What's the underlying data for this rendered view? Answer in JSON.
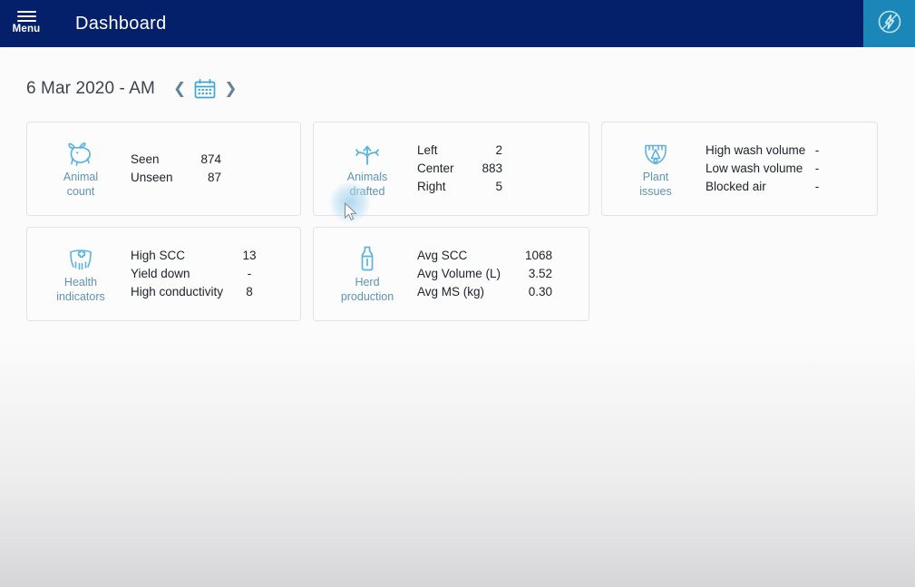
{
  "header": {
    "menu_label": "Menu",
    "menu_icon": "hamburger-icon",
    "title": "Dashboard",
    "power_icon": "lightning-bolt-circle-icon",
    "bg_color": "#04206a",
    "power_bg_color": "#1b87b9"
  },
  "date_bar": {
    "label": "6 Mar 2020 - AM",
    "prev_icon": "chevron-left-icon",
    "calendar_icon": "calendar-icon",
    "next_icon": "chevron-right-icon",
    "accent_color": "#63839c"
  },
  "cards": [
    {
      "id": "animal-count",
      "icon": "cow-icon",
      "title_line1": "Animal",
      "title_line2": "count",
      "stats": [
        {
          "name": "Seen",
          "value": "874"
        },
        {
          "name": "Unseen",
          "value": "87"
        }
      ]
    },
    {
      "id": "animals-drafted",
      "icon": "drafting-arrows-icon",
      "title_line1": "Animals",
      "title_line2": "drafted",
      "stats": [
        {
          "name": "Left",
          "value": "2"
        },
        {
          "name": "Center",
          "value": "883"
        },
        {
          "name": "Right",
          "value": "5"
        }
      ]
    },
    {
      "id": "plant-issues",
      "icon": "milking-cluster-icon",
      "title_line1": "Plant",
      "title_line2": "issues",
      "stats": [
        {
          "name": "High wash volume",
          "value": "-"
        },
        {
          "name": "Low wash volume",
          "value": "-"
        },
        {
          "name": "Blocked air",
          "value": "-"
        }
      ]
    },
    {
      "id": "health-indicators",
      "icon": "udder-health-cross-icon",
      "title_line1": "Health",
      "title_line2": "indicators",
      "stats": [
        {
          "name": "High SCC",
          "value": "13"
        },
        {
          "name": "Yield down",
          "value": "-"
        },
        {
          "name": "High conductivity",
          "value": "8"
        }
      ]
    },
    {
      "id": "herd-production",
      "icon": "milk-bottle-icon",
      "title_line1": "Herd",
      "title_line2": "production",
      "stats": [
        {
          "name": "Avg SCC",
          "value": "1068"
        },
        {
          "name": "Avg Volume (L)",
          "value": "3.52"
        },
        {
          "name": "Avg MS (kg)",
          "value": "0.30"
        }
      ]
    }
  ],
  "pointer": {
    "cursor_icon": "arrow-cursor",
    "ripple_icon": "tap-ripple-indicator"
  },
  "colors": {
    "icon_label": "#5d94b5",
    "icon_stroke": "#4ea5d4",
    "card_bg": "#fcfcfd",
    "card_border": "#e2e3e6",
    "stat_text": "#20242b"
  }
}
